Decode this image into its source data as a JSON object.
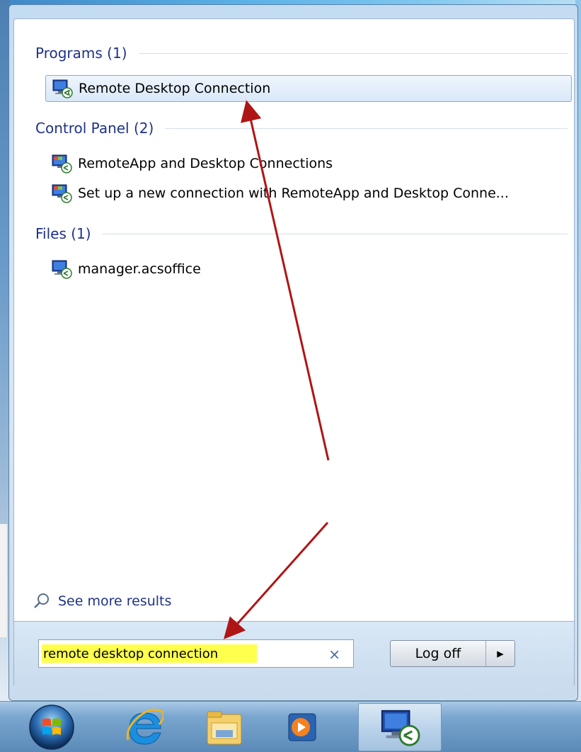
{
  "groups": [
    {
      "header": "Programs (1)",
      "items": [
        "Remote Desktop Connection"
      ]
    },
    {
      "header": "Control Panel (2)",
      "items": [
        "RemoteApp and Desktop Connections",
        "Set up a new connection with RemoteApp and Desktop Conne..."
      ]
    },
    {
      "header": "Files (1)",
      "items": [
        "manager.acsoffice"
      ]
    }
  ],
  "see_more": "See more results",
  "search": {
    "value": "remote desktop connection",
    "clear_glyph": "×"
  },
  "logoff": {
    "label": "Log off",
    "arrow_glyph": "▸"
  },
  "icons": {
    "result": "remote-desktop-icon",
    "see_more": "search-magnifier-icon",
    "taskbar": [
      "windows-start-orb-icon",
      "internet-explorer-icon",
      "file-explorer-icon",
      "media-player-icon",
      "remote-desktop-icon"
    ]
  },
  "colors": {
    "header_text": "#1e3287",
    "highlight": "#ffff4d",
    "annotation_arrow": "#b01515"
  }
}
